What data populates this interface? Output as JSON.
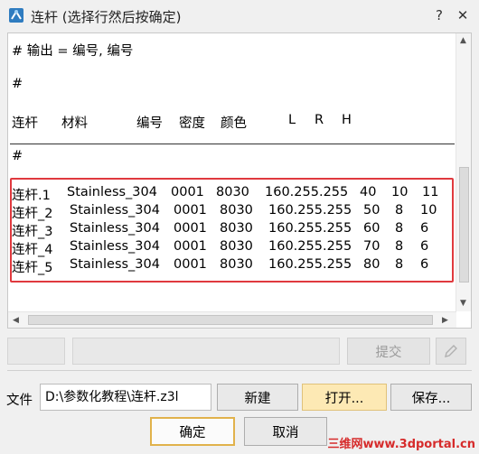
{
  "window": {
    "title": "连杆 (选择行然后按确定)",
    "help_glyph": "?",
    "close_glyph": "✕"
  },
  "editor": {
    "header_lines": [
      "# 输出 = 编号, 编号",
      "#"
    ],
    "columns": [
      "连杆",
      "材料",
      "编号",
      "密度",
      "颜色",
      "L",
      "R",
      "H"
    ],
    "comment_line": "#",
    "rows": [
      [
        "连杆.1",
        "Stainless_304",
        "0001",
        "8030",
        "160.255.255",
        "40",
        "10",
        "11"
      ],
      [
        "连杆_2",
        "Stainless_304",
        "0001",
        "8030",
        "160.255.255",
        "50",
        "8",
        "10"
      ],
      [
        "连杆_3",
        "Stainless_304",
        "0001",
        "8030",
        "160.255.255",
        "60",
        "8",
        "6"
      ],
      [
        "连杆_4",
        "Stainless_304",
        "0001",
        "8030",
        "160.255.255",
        "70",
        "8",
        "6"
      ],
      [
        "连杆_5",
        "Stainless_304",
        "0001",
        "8030",
        "160.255.255",
        "80",
        "8",
        "6"
      ]
    ],
    "highlight_color": "#e0393e"
  },
  "commit": {
    "submit_label": "提交"
  },
  "file": {
    "label": "文件",
    "path": "D:\\参数化教程\\连杆.z3l",
    "new_label": "新建",
    "open_label": "打开...",
    "save_label": "保存..."
  },
  "dialog": {
    "ok_label": "确定",
    "cancel_label": "取消"
  },
  "watermark": "三维网www.3dportal.cn",
  "icons": {
    "app": "link-icon",
    "help": "help-icon",
    "close": "close-icon",
    "edit": "pencil-icon"
  }
}
